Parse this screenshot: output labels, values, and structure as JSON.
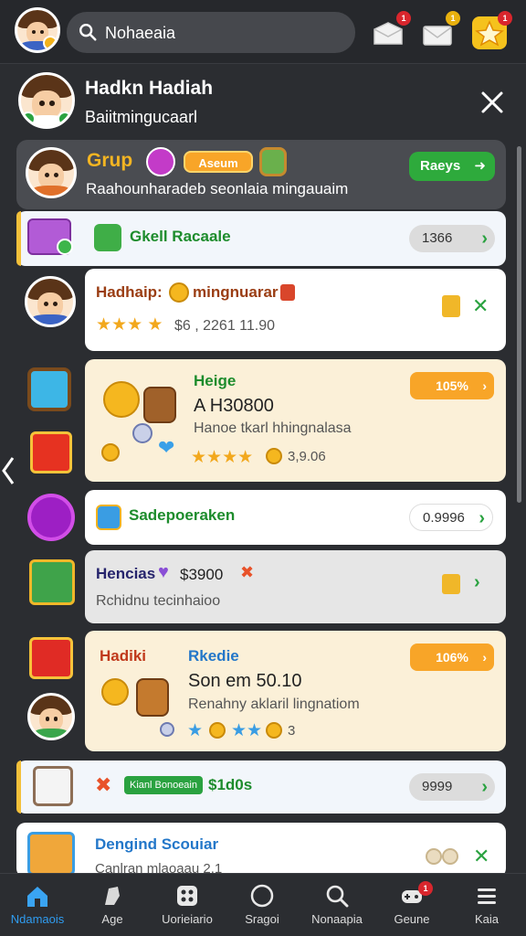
{
  "search": {
    "value": "Nohaeaia"
  },
  "top_icons": [
    {
      "name": "inbox-icon",
      "badge": "1",
      "badge_color": "#d9262d"
    },
    {
      "name": "mail-icon",
      "badge": "1",
      "badge_color": "#e9b10e"
    },
    {
      "name": "star-icon",
      "badge": "1",
      "badge_color": "#d9262d"
    }
  ],
  "header": {
    "title": "Hadkn Hadiah",
    "subtitle": "Baiitmingucaarl"
  },
  "group": {
    "title": "Grup",
    "tag": "Aseum",
    "subtitle": "Raahounharadeb seonlaia mingauaim",
    "button": "Raeys"
  },
  "rows": [
    {
      "title": "Gkell Racaale",
      "pill": "1366"
    },
    {
      "title": "Hadhaip:",
      "title2": "mingnuarar",
      "subtitle": "$6 , 2261 11.90"
    },
    {
      "title": "Heige",
      "amount": "A H30800",
      "desc": "Hanoe tkarl hhingnalasa",
      "badge": "105%",
      "value": "3,9.06"
    },
    {
      "title": "Sadepoeraken",
      "pill": "0.9996"
    },
    {
      "title": "Hencias",
      "amount": "$3900",
      "subtitle": "Rchidnu tecinhaioo"
    },
    {
      "title": "Hadiki",
      "title2": "Rkedie",
      "amount": "Son em 50.10",
      "desc": "Renahny aklaril lingnatiom",
      "badge": "106%",
      "value": "3"
    },
    {
      "tag": "Kianl Bonoeain",
      "title": "$1d0s",
      "pill": "9999"
    },
    {
      "title": "Dengind Scouiar",
      "subtitle": "Canlran mlaoaau 2.1"
    }
  ],
  "nav": [
    {
      "label": "Ndamaois",
      "icon": "home-icon"
    },
    {
      "label": "Age",
      "icon": "tag-icon"
    },
    {
      "label": "Uorieiario",
      "icon": "grid-icon"
    },
    {
      "label": "Sragoi",
      "icon": "circle-icon"
    },
    {
      "label": "Nonaapia",
      "icon": "search-icon"
    },
    {
      "label": "Geune",
      "icon": "gamepad-icon",
      "badge": "1"
    },
    {
      "label": "Kaia",
      "icon": "menu-icon"
    }
  ]
}
